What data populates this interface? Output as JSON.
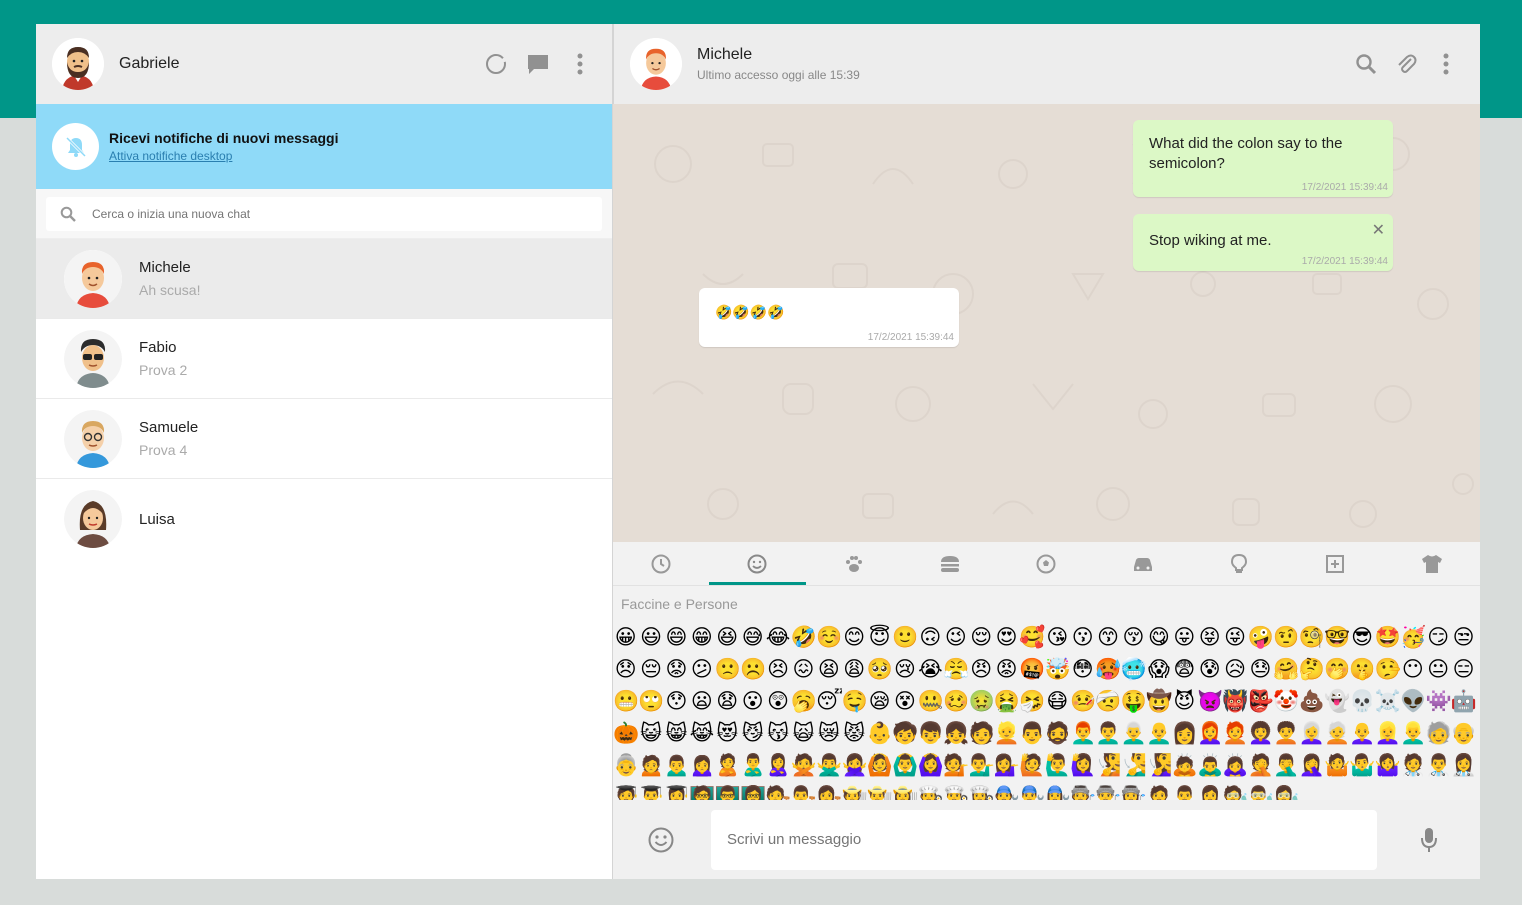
{
  "colors": {
    "accent": "#009688",
    "notif_bg": "#8fdaf8",
    "sent_bubble": "#dcf8c6",
    "chat_bg": "#e5ddd5"
  },
  "user": {
    "name": "Gabriele",
    "avatar_icon": "bearded-man-avatar"
  },
  "sidebar_header_icons": [
    "status-icon",
    "new-chat-icon",
    "menu-dots-icon"
  ],
  "notification": {
    "title": "Ricevi notifiche di nuovi messaggi",
    "link": "Attiva notifiche desktop",
    "icon": "muted-bell-icon"
  },
  "search": {
    "placeholder": "Cerca o inizia una nuova chat"
  },
  "chats": [
    {
      "name": "Michele",
      "last": "Ah scusa!",
      "active": true
    },
    {
      "name": "Fabio",
      "last": "Prova 2",
      "active": false
    },
    {
      "name": "Samuele",
      "last": "Prova 4",
      "active": false
    },
    {
      "name": "Luisa",
      "last": "",
      "active": false
    }
  ],
  "conversation": {
    "name": "Michele",
    "status": "Ultimo accesso oggi alle 15:39",
    "header_icons": [
      "search-icon",
      "attach-icon",
      "menu-dots-icon"
    ],
    "messages": [
      {
        "type": "sent",
        "text": "What did the colon say to the semicolon?",
        "time": "17/2/2021 15:39:44"
      },
      {
        "type": "sent",
        "text": "Stop wiking at me.",
        "time": "17/2/2021 15:39:44",
        "close": "✕"
      },
      {
        "type": "recv",
        "text": "🤣🤣🤣🤣",
        "time": "17/2/2021 15:39:44"
      }
    ]
  },
  "emoji_panel": {
    "tabs": [
      "recent-icon",
      "smiley-icon",
      "paw-icon",
      "burger-icon",
      "ball-icon",
      "car-icon",
      "bulb-icon",
      "symbols-icon",
      "shirt-icon"
    ],
    "active_tab": 1,
    "category": "Faccine e Persone",
    "emojis": "😀😃😄😁😆😅😂🤣☺️😊😇🙂🙃😉😌😍🥰😘😗😙😚😋😛😝😜🤪🤨🧐🤓😎🤩🥳😏😒😞😔😟😕🙁☹️😣😖😫😩🥺😢😭😤😠😡🤬🤯😳🥵🥶😱😨😰😥😓🤗🤔🤭🤫🤥😶😐😑😬🙄😯😦😧😮😲🥱😴🤤😪😵🤐🥴🤢🤮🤧😷🤒🤕🤑🤠😈👿👹👺🤡💩👻💀☠️👽👾🤖🎃😺😸😹😻😼😽🙀😿😾👶🧒👦👧🧑👱👨🧔👨‍🦰👨‍🦱👨‍🦳👨‍🦲👩👩‍🦰🧑‍🦰👩‍🦱🧑‍🦱👩‍🦳🧑‍🦳👩‍🦲👱‍♀️👱‍♂️🧓👴👵🙍🙍‍♂️🙍‍♀️🙎🙎‍♂️🙎‍♀️🙅🙅‍♂️🙅‍♀️🙆🙆‍♂️🙆‍♀️💁💁‍♂️💁‍♀️🙋🙋‍♂️🙋‍♀️🧏🧏‍♂️🧏‍♀️🙇🙇‍♂️🙇‍♀️🤦🤦‍♂️🤦‍♀️🤷🤷‍♂️🤷‍♀️🧑‍⚕️👨‍⚕️👩‍⚕️🧑‍🎓👨‍🎓👩‍🎓🧑‍🏫👨‍🏫👩‍🏫🧑‍⚖️👨‍⚖️👩‍⚖️🧑‍🌾👨‍🌾👩‍🌾🧑‍🍳👨‍🍳👩‍🍳🧑‍🔧👨‍🔧👩‍🔧🧑‍🏭👨‍🏭👩‍🏭🧑‍💼👨‍💼👩‍💼🧑‍🔬👨‍🔬👩‍🔬"
  },
  "composer": {
    "placeholder": "Scrivi un messaggio",
    "emoji_icon": "smiley-icon",
    "mic_icon": "mic-icon"
  }
}
